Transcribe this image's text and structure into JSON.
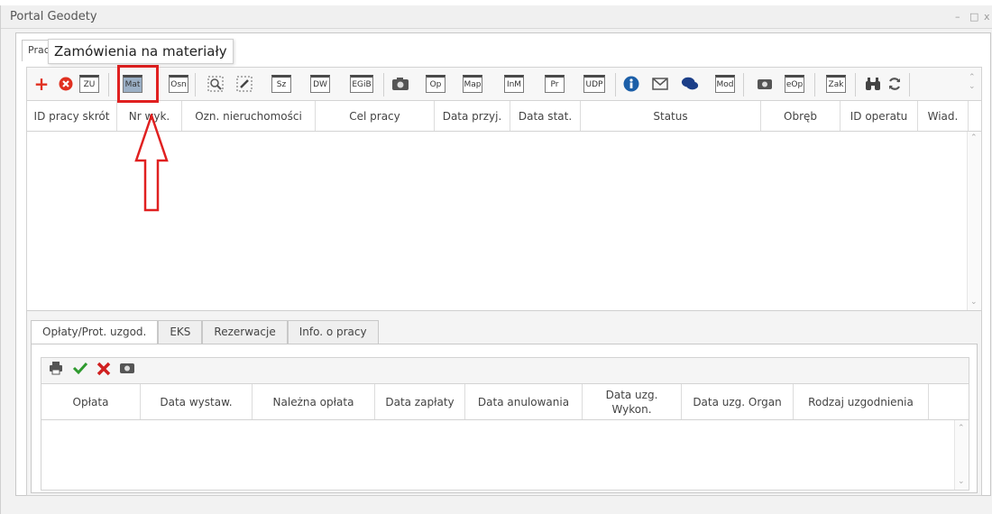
{
  "window": {
    "title": "Portal Geodety",
    "controls": [
      "–",
      "□",
      "x"
    ]
  },
  "top_tab": {
    "label": "Prac"
  },
  "tooltip": {
    "text": "Zamówienia na materiały"
  },
  "toolbar": {
    "text_buttons": {
      "zu": "ZU",
      "mat": "Mat",
      "osn": "Osn",
      "sz": "Sz",
      "dw": "DW",
      "egib": "EGiB",
      "op": "Op",
      "map": "Map",
      "inm": "InM",
      "pr": "Pr",
      "udp": "UDP",
      "mod": "Mod",
      "eop": "eOp",
      "zak": "Zak"
    },
    "icons": [
      "plus-icon",
      "cancel-circle-icon",
      "zoom-select-icon",
      "edit-select-icon",
      "camera-icon",
      "info-icon",
      "envelope-icon",
      "chat-bubbles-icon",
      "camera-icon",
      "binoculars-icon",
      "refresh-icon"
    ]
  },
  "main_grid": {
    "columns": [
      "ID pracy skrót",
      "Nr wyk.",
      "Ozn. nieruchomości",
      "Cel pracy",
      "Data przyj.",
      "Data stat.",
      "Status",
      "Obręb",
      "ID operatu",
      "Wiad."
    ]
  },
  "lower_tabs": [
    "Opłaty/Prot. uzgod.",
    "EKS",
    "Rezerwacje",
    "Info. o pracy"
  ],
  "lower_grid": {
    "columns": [
      "Opłata",
      "Data wystaw.",
      "Należna opłata",
      "Data zapłaty",
      "Data anulowania",
      "Data uzg. Wykon.",
      "Data uzg. Organ",
      "Rodzaj uzgodnienia"
    ]
  },
  "colors": {
    "highlight": "#e02020",
    "plus": "#e03020",
    "cancel": "#e03020",
    "check": "#2f9a2f",
    "info": "#1c5fa8"
  }
}
